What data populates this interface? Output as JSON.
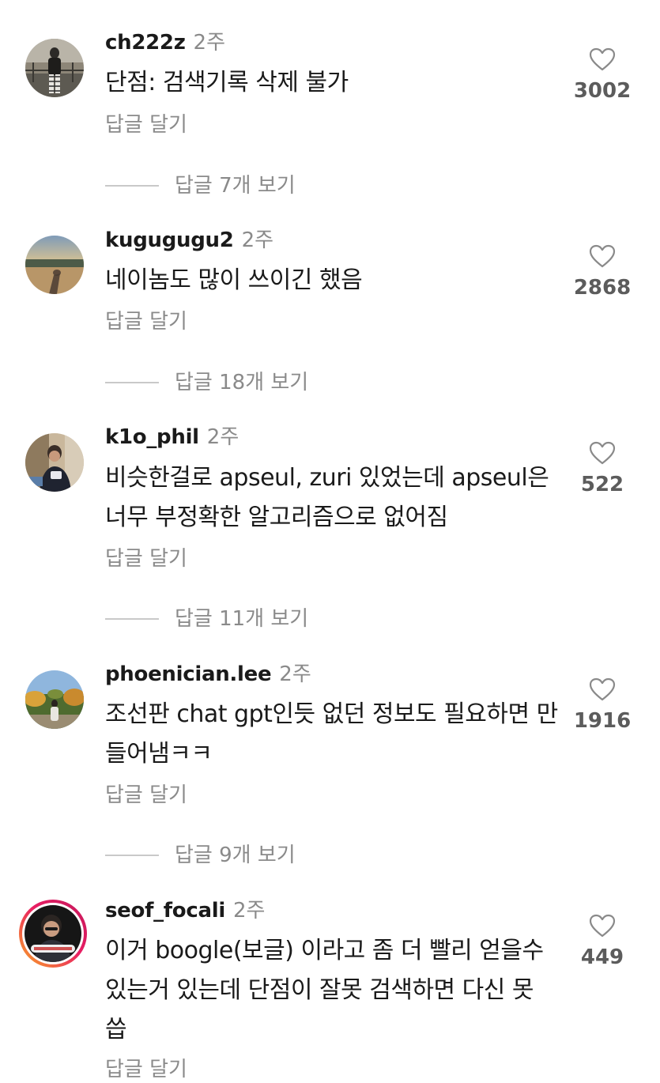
{
  "comments": [
    {
      "username": "ch222z",
      "time": "2주",
      "text": "단점: 검색기록 삭제 불가",
      "likes": "3002",
      "reply_label": "답글 달기",
      "view_replies": "답글 7개 보기",
      "avatar": "person-standing-outdoors"
    },
    {
      "username": "kugugugu2",
      "time": "2주",
      "text": "네이놈도 많이 쓰이긴 했음",
      "likes": "2868",
      "reply_label": "답글 달기",
      "view_replies": "답글 18개 보기",
      "avatar": "shadow-on-ground-sunset"
    },
    {
      "username": "k1o_phil",
      "time": "2주",
      "text": "비슷한걸로 apseul, zuri 있었는데 apseul은 너무 부정확한 알고리즘으로 없어짐",
      "likes": "522",
      "reply_label": "답글 달기",
      "view_replies": "답글 11개 보기",
      "avatar": "man-reading-phone"
    },
    {
      "username": "phoenician.lee",
      "time": "2주",
      "text": "조선판 chat gpt인듯 없던 정보도 필요하면 만들어냄ㅋㅋ",
      "likes": "1916",
      "reply_label": "답글 달기",
      "view_replies": "답글 9개 보기",
      "avatar": "person-in-autumn-park"
    },
    {
      "username": "seof_focali",
      "time": "2주",
      "text": "이거 boogle(보글) 이라고 좀 더 빨리 얻을수 있는거 있는데 단점이 잘못 검색하면 다신 못씁",
      "likes": "449",
      "reply_label": "답글 달기",
      "avatar": "man-with-caption-story"
    }
  ]
}
